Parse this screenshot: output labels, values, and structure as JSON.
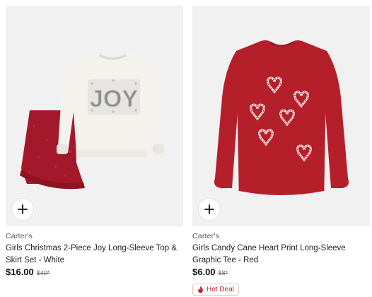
{
  "products": [
    {
      "brand": "Carter's",
      "title": "Girls Christmas 2-Piece Joy Long-Sleeve Top & Skirt Set - White",
      "price": "$16.00",
      "original_price": "$40*",
      "image_text": "JOY"
    },
    {
      "brand": "Carter's",
      "title": "Girls Candy Cane Heart Print Long-Sleeve Graphic Tee - Red",
      "price": "$6.00",
      "original_price": "$8*",
      "badge": "Hot Deal"
    }
  ],
  "icons": {
    "add": "plus-icon",
    "deal": "flame-icon"
  },
  "colors": {
    "deal_red": "#c0252c",
    "tee_red": "#b51f2a",
    "image_bg": "#f1f1f1"
  }
}
